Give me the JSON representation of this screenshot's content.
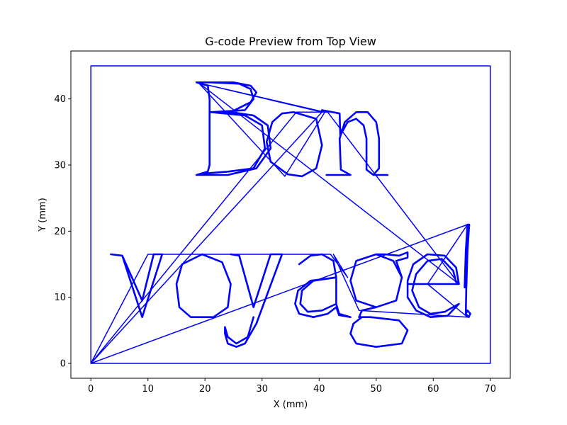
{
  "chart_data": {
    "type": "line",
    "title": "G-code Preview from Top View",
    "xlabel": "X (mm)",
    "ylabel": "Y (mm)",
    "xlim": [
      -3.5,
      73.5
    ],
    "ylim": [
      -2.25,
      47.25
    ],
    "xticks": [
      0,
      10,
      20,
      30,
      40,
      50,
      60,
      70
    ],
    "yticks": [
      0,
      10,
      20,
      30,
      40
    ],
    "grid": false,
    "line_color": "#0000ff",
    "series": [
      {
        "label": "border",
        "points": [
          [
            0,
            0
          ],
          [
            70,
            0
          ],
          [
            70,
            45
          ],
          [
            0,
            45
          ],
          [
            0,
            0
          ]
        ]
      },
      {
        "label": "travel-moves",
        "points": [
          [
            0,
            0
          ],
          [
            40.5,
            38
          ],
          [
            18.5,
            42.5
          ],
          [
            41,
            38
          ],
          [
            34,
            28.3
          ],
          [
            18.8,
            42.5
          ],
          [
            64.5,
            12
          ],
          [
            41.5,
            38
          ],
          [
            36,
            38
          ],
          [
            0,
            0
          ],
          [
            10,
            16.5
          ],
          [
            25,
            16.5
          ],
          [
            42,
            16.5
          ],
          [
            45,
            13
          ],
          [
            42.5,
            16.5
          ],
          [
            47,
            8
          ],
          [
            66,
            7
          ],
          [
            59,
            12
          ],
          [
            66,
            21
          ],
          [
            0,
            0
          ]
        ]
      },
      {
        "label": "glyph-B",
        "points": [
          [
            18.5,
            28.5
          ],
          [
            24,
            28.5
          ],
          [
            29,
            29.5
          ],
          [
            31.5,
            32.5
          ],
          [
            31,
            36
          ],
          [
            28.5,
            37.5
          ],
          [
            24.5,
            38
          ],
          [
            21,
            38
          ],
          [
            24.5,
            38
          ],
          [
            28,
            39.5
          ],
          [
            29,
            41
          ],
          [
            28,
            42
          ],
          [
            25,
            42.5
          ],
          [
            18.5,
            42.5
          ],
          [
            20.5,
            42
          ],
          [
            20.8,
            40
          ],
          [
            20.8,
            30
          ],
          [
            20.5,
            29
          ],
          [
            18.5,
            28.5
          ],
          [
            21,
            28.8
          ],
          [
            24,
            29
          ],
          [
            28.5,
            29.5
          ],
          [
            30.5,
            32.5
          ],
          [
            30,
            36
          ],
          [
            27,
            37.5
          ],
          [
            21,
            38
          ],
          [
            27,
            38.3
          ],
          [
            28.5,
            40
          ],
          [
            28,
            41.5
          ],
          [
            26,
            42.3
          ],
          [
            21,
            42.5
          ]
        ]
      },
      {
        "label": "glyph-o-upper",
        "points": [
          [
            35.5,
            38
          ],
          [
            39.5,
            37
          ],
          [
            40.5,
            33
          ],
          [
            39.5,
            29.5
          ],
          [
            37,
            28.3
          ],
          [
            34.5,
            28.6
          ],
          [
            31.5,
            30.5
          ],
          [
            30.8,
            33.5
          ],
          [
            31.8,
            36.5
          ],
          [
            33.5,
            37.8
          ],
          [
            35.5,
            38
          ]
        ]
      },
      {
        "label": "glyph-n",
        "points": [
          [
            41.3,
            28.5
          ],
          [
            45.5,
            28.5
          ],
          [
            43.8,
            29.3
          ],
          [
            43.6,
            34
          ],
          [
            44.5,
            36.5
          ],
          [
            46.5,
            38
          ],
          [
            48.5,
            38
          ],
          [
            50,
            36.5
          ],
          [
            50.5,
            34
          ],
          [
            50.5,
            29.5
          ],
          [
            49.5,
            28.5
          ],
          [
            52,
            28.5
          ],
          [
            49.5,
            28.5
          ],
          [
            48.3,
            29.3
          ],
          [
            48.3,
            34
          ],
          [
            47.8,
            36
          ],
          [
            46.5,
            37
          ],
          [
            45,
            36.5
          ],
          [
            43.7,
            34.5
          ],
          [
            43.6,
            37.8
          ],
          [
            40.5,
            38.3
          ]
        ]
      },
      {
        "label": "glyph-v",
        "points": [
          [
            3.5,
            16.5
          ],
          [
            5.5,
            16.3
          ],
          [
            9,
            7
          ],
          [
            12.5,
            16.5
          ],
          [
            11,
            16.5
          ],
          [
            9,
            9.5
          ],
          [
            5.5,
            16.3
          ]
        ]
      },
      {
        "label": "glyph-o-lower",
        "points": [
          [
            19.5,
            16.5
          ],
          [
            23,
            15.3
          ],
          [
            24.5,
            12
          ],
          [
            24,
            8.5
          ],
          [
            21.5,
            7
          ],
          [
            17.5,
            7
          ],
          [
            15.5,
            8.5
          ],
          [
            15,
            12
          ],
          [
            16,
            15
          ],
          [
            19.5,
            16.5
          ]
        ]
      },
      {
        "label": "glyph-y",
        "points": [
          [
            24.5,
            16.5
          ],
          [
            26,
            16.3
          ],
          [
            28.5,
            8.5
          ],
          [
            31.5,
            16.5
          ],
          [
            33.5,
            16.5
          ],
          [
            29,
            6
          ],
          [
            27,
            3
          ],
          [
            25.5,
            2.5
          ],
          [
            24,
            3
          ],
          [
            23.5,
            4.5
          ],
          [
            23.5,
            5.5
          ],
          [
            24,
            4
          ],
          [
            25.5,
            3
          ],
          [
            27.5,
            4
          ],
          [
            28.5,
            7
          ]
        ]
      },
      {
        "label": "glyph-a",
        "points": [
          [
            36.5,
            15
          ],
          [
            38.5,
            16.3
          ],
          [
            40.5,
            16.5
          ],
          [
            42.5,
            15.5
          ],
          [
            43,
            13
          ],
          [
            43,
            9
          ],
          [
            43.5,
            7.5
          ],
          [
            45.5,
            7
          ],
          [
            43.5,
            7.3
          ],
          [
            43,
            8.5
          ],
          [
            41.5,
            7.5
          ],
          [
            39,
            7
          ],
          [
            36.5,
            7.5
          ],
          [
            35.8,
            9
          ],
          [
            36.3,
            11
          ],
          [
            38.5,
            12.5
          ],
          [
            43,
            13
          ],
          [
            39,
            12.5
          ],
          [
            37,
            11
          ],
          [
            36.7,
            9
          ],
          [
            38,
            7.8
          ],
          [
            40.5,
            8
          ],
          [
            43,
            9
          ]
        ]
      },
      {
        "label": "glyph-g",
        "points": [
          [
            50,
            16.5
          ],
          [
            53,
            15.5
          ],
          [
            54.5,
            13
          ],
          [
            53.5,
            9.5
          ],
          [
            50,
            8.5
          ],
          [
            46.5,
            9.5
          ],
          [
            45.5,
            12.5
          ],
          [
            46.5,
            15.5
          ],
          [
            50,
            16.5
          ],
          [
            51.5,
            16.5
          ],
          [
            54,
            16.3
          ],
          [
            55.5,
            16.8
          ],
          [
            55.5,
            16
          ],
          [
            53.5,
            15.5
          ],
          [
            54.5,
            13
          ],
          [
            53.5,
            9.5
          ],
          [
            50,
            8.5
          ],
          [
            47.5,
            8
          ],
          [
            47,
            7
          ],
          [
            49,
            7
          ],
          [
            54,
            6.5
          ],
          [
            55.5,
            5
          ],
          [
            54.5,
            3
          ],
          [
            50,
            2.5
          ],
          [
            46.5,
            3
          ],
          [
            45.5,
            4.5
          ],
          [
            46,
            6
          ],
          [
            47.5,
            7
          ]
        ]
      },
      {
        "label": "glyph-e",
        "points": [
          [
            55.5,
            12
          ],
          [
            64.5,
            12
          ],
          [
            64,
            14.5
          ],
          [
            62,
            16.3
          ],
          [
            59,
            16.5
          ],
          [
            56.5,
            15
          ],
          [
            55.5,
            12.5
          ],
          [
            55.5,
            10
          ],
          [
            57,
            8
          ],
          [
            59.5,
            7
          ],
          [
            62.5,
            7.2
          ],
          [
            64.5,
            9
          ],
          [
            62,
            7.8
          ],
          [
            59.5,
            7.5
          ],
          [
            57.5,
            8.5
          ],
          [
            56.3,
            11
          ],
          [
            57,
            13.5
          ],
          [
            59,
            15.5
          ],
          [
            61.5,
            15.8
          ],
          [
            63.5,
            14
          ],
          [
            64,
            12.3
          ]
        ]
      },
      {
        "label": "glyph-exclaim",
        "points": [
          [
            66,
            21
          ],
          [
            66.3,
            21
          ],
          [
            66,
            17
          ],
          [
            65.8,
            11.5
          ],
          [
            65.5,
            11.5
          ],
          [
            65.7,
            17
          ],
          [
            66,
            21
          ],
          [
            65.7,
            7.5
          ],
          [
            66.2,
            7
          ],
          [
            66.5,
            7.5
          ],
          [
            66,
            8
          ],
          [
            65.7,
            7.5
          ]
        ]
      }
    ]
  }
}
